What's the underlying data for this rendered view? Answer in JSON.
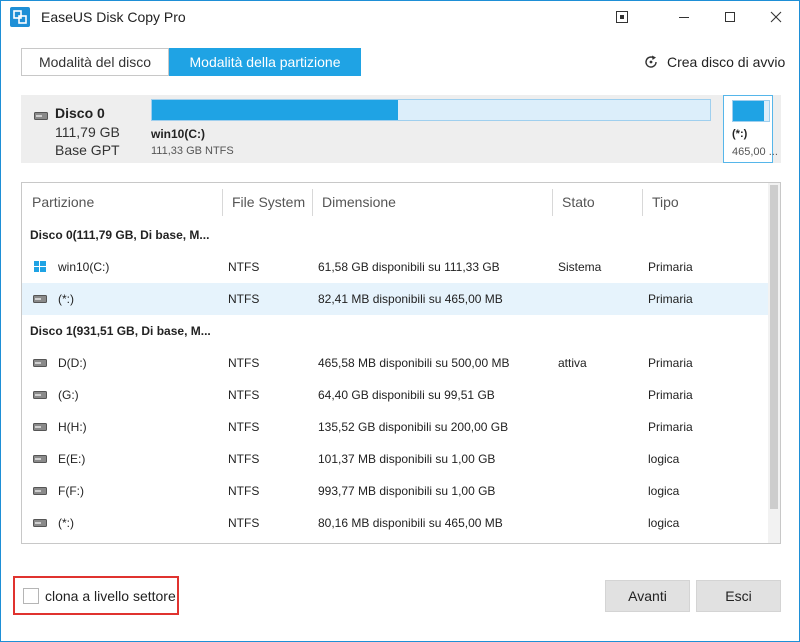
{
  "window": {
    "title": "EaseUS Disk Copy Pro"
  },
  "tabs": {
    "disk_mode": "Modalità del disco",
    "partition_mode": "Modalità della partizione"
  },
  "boot_disk_link": "Crea disco di avvio",
  "disk_panel": {
    "name": "Disco 0",
    "size": "111,79 GB",
    "style": "Base GPT",
    "main_partition": {
      "label": "win10(C:)",
      "detail": "111,33 GB NTFS",
      "used_fraction": 0.44
    },
    "small_partition": {
      "label": "(*:)",
      "detail": "465,00 ...",
      "used_fraction": 0.86
    }
  },
  "table": {
    "headers": [
      "Partizione",
      "File System",
      "Dimensione",
      "Stato",
      "Tipo"
    ],
    "groups": [
      {
        "label": "Disco 0(111,79 GB, Di base, M...",
        "rows": [
          {
            "name": "win10(C:)",
            "fs": "NTFS",
            "size": "61,58 GB disponibili su 111,33 GB",
            "state": "Sistema",
            "type": "Primaria",
            "icon": "windows-icon",
            "selected": false
          },
          {
            "name": "(*:)",
            "fs": "NTFS",
            "size": "82,41 MB disponibili su 465,00 MB",
            "state": "",
            "type": "Primaria",
            "icon": "drive-icon",
            "selected": true
          }
        ]
      },
      {
        "label": "Disco 1(931,51 GB, Di base, M...",
        "rows": [
          {
            "name": "D(D:)",
            "fs": "NTFS",
            "size": "465,58 MB disponibili su 500,00 MB",
            "state": "attiva",
            "type": "Primaria",
            "icon": "drive-icon",
            "selected": false
          },
          {
            "name": "(G:)",
            "fs": "NTFS",
            "size": "64,40 GB disponibili su 99,51 GB",
            "state": "",
            "type": "Primaria",
            "icon": "drive-icon",
            "selected": false
          },
          {
            "name": "H(H:)",
            "fs": "NTFS",
            "size": "135,52 GB disponibili su 200,00 GB",
            "state": "",
            "type": "Primaria",
            "icon": "drive-icon",
            "selected": false
          },
          {
            "name": "E(E:)",
            "fs": "NTFS",
            "size": "101,37 MB disponibili su 1,00 GB",
            "state": "",
            "type": "logica",
            "icon": "drive-icon",
            "selected": false
          },
          {
            "name": "F(F:)",
            "fs": "NTFS",
            "size": "993,77 MB disponibili su 1,00 GB",
            "state": "",
            "type": "logica",
            "icon": "drive-icon",
            "selected": false
          },
          {
            "name": "(*:)",
            "fs": "NTFS",
            "size": "80,16 MB disponibili su 465,00 MB",
            "state": "",
            "type": "logica",
            "icon": "drive-icon",
            "selected": false
          }
        ]
      }
    ]
  },
  "sector_clone_label": "clona a livello settore",
  "buttons": {
    "next": "Avanti",
    "exit": "Esci"
  },
  "colors": {
    "accent": "#1fa3e4",
    "highlight_border": "#e0332f"
  }
}
